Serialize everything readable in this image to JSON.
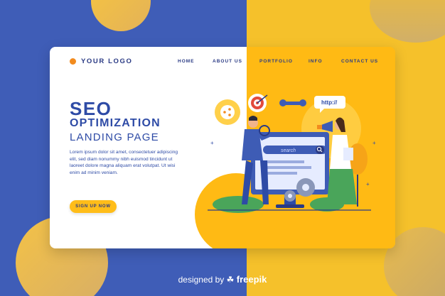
{
  "brand": {
    "logo_text": "YOUR LOGO"
  },
  "nav": {
    "items": [
      "HOME",
      "ABOUT US",
      "PORTFOLIO",
      "INFO",
      "CONTACT US"
    ]
  },
  "hero": {
    "title_line1": "SEO",
    "title_line2": "OPTIMIZATION",
    "title_line3": "LANDING PAGE",
    "description": "Lorem ipsum dolor sit amet, consectetuer adipiscing elit, sed diam nonummy nibh euismod tincidunt ut laoreet dolore magna aliquam erat volutpat. Ut wisi enim ad minim veniam.",
    "cta_label": "SIGN UP NOW"
  },
  "illustration": {
    "search_label": "search",
    "bubble_text": "http://"
  },
  "footer": {
    "credit_prefix": "designed by",
    "credit_brand": "freepik"
  },
  "colors": {
    "blue": "#3f5db7",
    "yellow": "#ffba14",
    "accent_orange": "#f28b1e",
    "text_blue": "#2e4ba6"
  }
}
